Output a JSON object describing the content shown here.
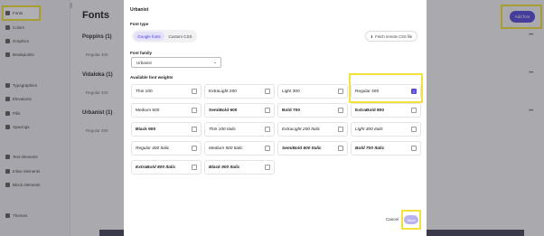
{
  "sidebar": {
    "items": [
      {
        "label": "Fonts",
        "icon": "font-icon"
      },
      {
        "label": "Colors",
        "icon": "palette-icon"
      },
      {
        "label": "Graphics",
        "icon": "graphics-icon"
      },
      {
        "label": "Breakpoints",
        "icon": "breakpoints-icon"
      },
      {
        "label": "Typographies",
        "icon": "typography-icon"
      },
      {
        "label": "Elevations",
        "icon": "layers-icon"
      },
      {
        "label": "Pills",
        "icon": "pill-icon"
      },
      {
        "label": "Spacings",
        "icon": "spacing-icon"
      },
      {
        "label": "Text elements",
        "icon": "text-element-icon"
      },
      {
        "label": "Inline elements",
        "icon": "inline-element-icon"
      },
      {
        "label": "Block elements",
        "icon": "block-element-icon"
      },
      {
        "label": "Themes",
        "icon": "themes-icon"
      }
    ]
  },
  "main": {
    "title": "Fonts",
    "add_font_label": "Add font",
    "groups": [
      {
        "name": "Poppins (1)",
        "sub": "Regular 400"
      },
      {
        "name": "Vidaloka (1)",
        "sub": "Regular 400"
      },
      {
        "name": "Urbanist (1)",
        "sub": "Regular 400"
      }
    ]
  },
  "modal": {
    "title": "Urbanist",
    "font_type_label": "Font type",
    "tabs": [
      "Google fonts",
      "Custom CSS"
    ],
    "fetch_label": "Fetch remote CSS file",
    "font_family_label": "Font family",
    "font_family_value": "Urbanist",
    "weights_label": "Available font weights",
    "weights": [
      {
        "label": "Thin 100",
        "checked": false
      },
      {
        "label": "ExtraLight 200",
        "checked": false
      },
      {
        "label": "Light 300",
        "checked": false
      },
      {
        "label": "Regular 400",
        "checked": true
      },
      {
        "label": "Medium 500",
        "checked": false
      },
      {
        "label": "SemiBold 600",
        "checked": false
      },
      {
        "label": "Bold 700",
        "checked": false
      },
      {
        "label": "ExtraBold 800",
        "checked": false
      },
      {
        "label": "Black 900",
        "checked": false
      },
      {
        "label": "Thin 100 Italic",
        "checked": false
      },
      {
        "label": "ExtraLight 200 Italic",
        "checked": false
      },
      {
        "label": "Light 300 Italic",
        "checked": false
      },
      {
        "label": "Regular 400 Italic",
        "checked": false
      },
      {
        "label": "Medium 500 Italic",
        "checked": false
      },
      {
        "label": "SemiBold 600 Italic",
        "checked": false
      },
      {
        "label": "Bold 700 Italic",
        "checked": false
      },
      {
        "label": "ExtraBold 800 Italic",
        "checked": false
      },
      {
        "label": "Black 900 Italic",
        "checked": false
      }
    ],
    "cancel_label": "Cancel",
    "save_label": "Save"
  },
  "colors": {
    "accent": "#5a4fd6",
    "highlight": "#f2e23a"
  }
}
